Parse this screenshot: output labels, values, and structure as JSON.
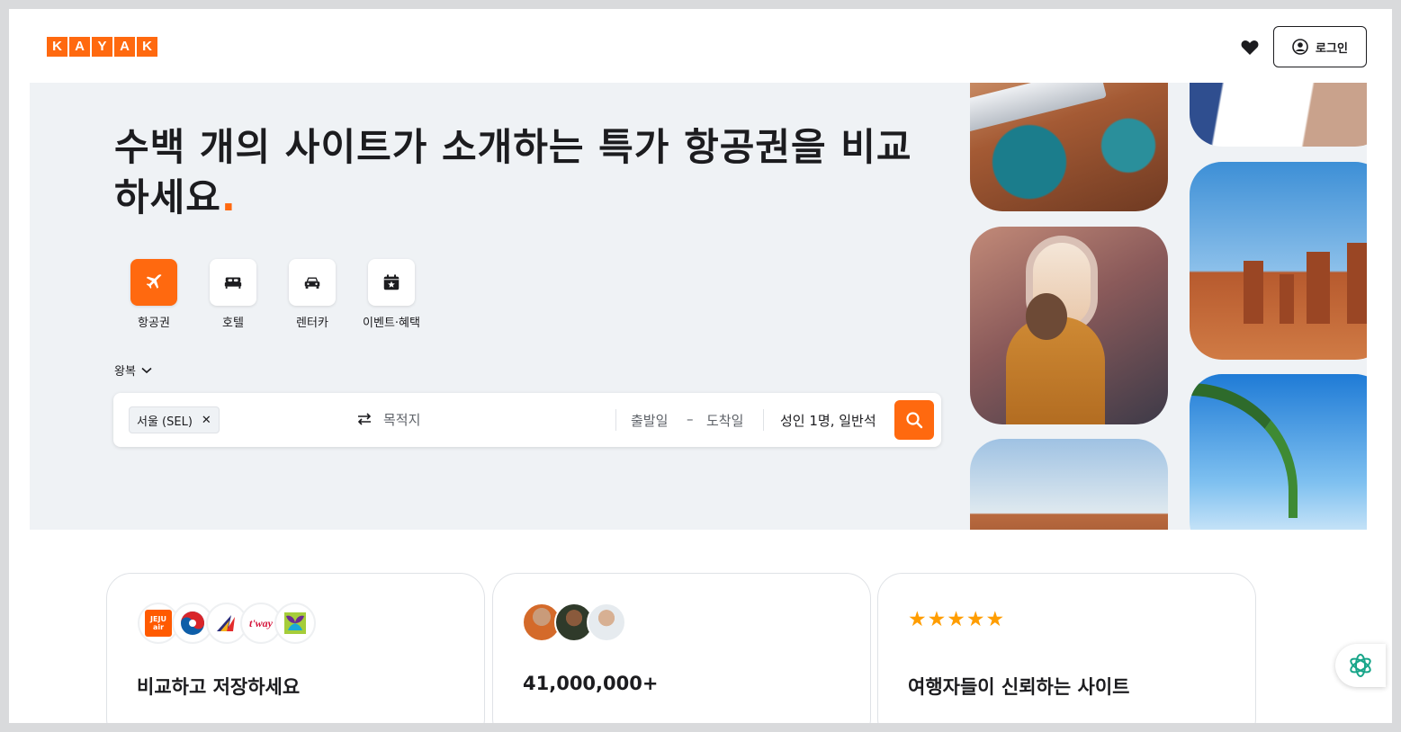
{
  "brand": {
    "logo_letters": [
      "K",
      "A",
      "Y",
      "A",
      "K"
    ],
    "accent": "#ff690f"
  },
  "header": {
    "login_label": "로그인"
  },
  "hero": {
    "title": "수백 개의 사이트가 소개하는 특가 항공권을 비교하세요",
    "title_dot": ".",
    "verticals": [
      {
        "label": "항공권",
        "icon": "plane-icon",
        "active": true
      },
      {
        "label": "호텔",
        "icon": "bed-icon",
        "active": false
      },
      {
        "label": "렌터카",
        "icon": "car-icon",
        "active": false
      },
      {
        "label": "이벤트·혜택",
        "icon": "calendar-star-icon",
        "active": false
      }
    ],
    "trip_type": "왕복"
  },
  "search": {
    "origin": "서울 (SEL)",
    "destination_placeholder": "목적지",
    "depart_placeholder": "출발일",
    "dash": "–",
    "return_placeholder": "도착일",
    "travelers": "성인 1명, 일반석"
  },
  "cards": [
    {
      "title": "비교하고 저장하세요",
      "airlines": [
        "JEJU air",
        "Korean Air",
        "Asiana",
        "t'way",
        "Jin Air"
      ]
    },
    {
      "title": "41,000,000+"
    },
    {
      "title": "여행자들이 신뢰하는 사이트",
      "stars": "★★★★★"
    }
  ],
  "airline_labels": {
    "jeju": "JEJU air",
    "tway": "t'way"
  }
}
